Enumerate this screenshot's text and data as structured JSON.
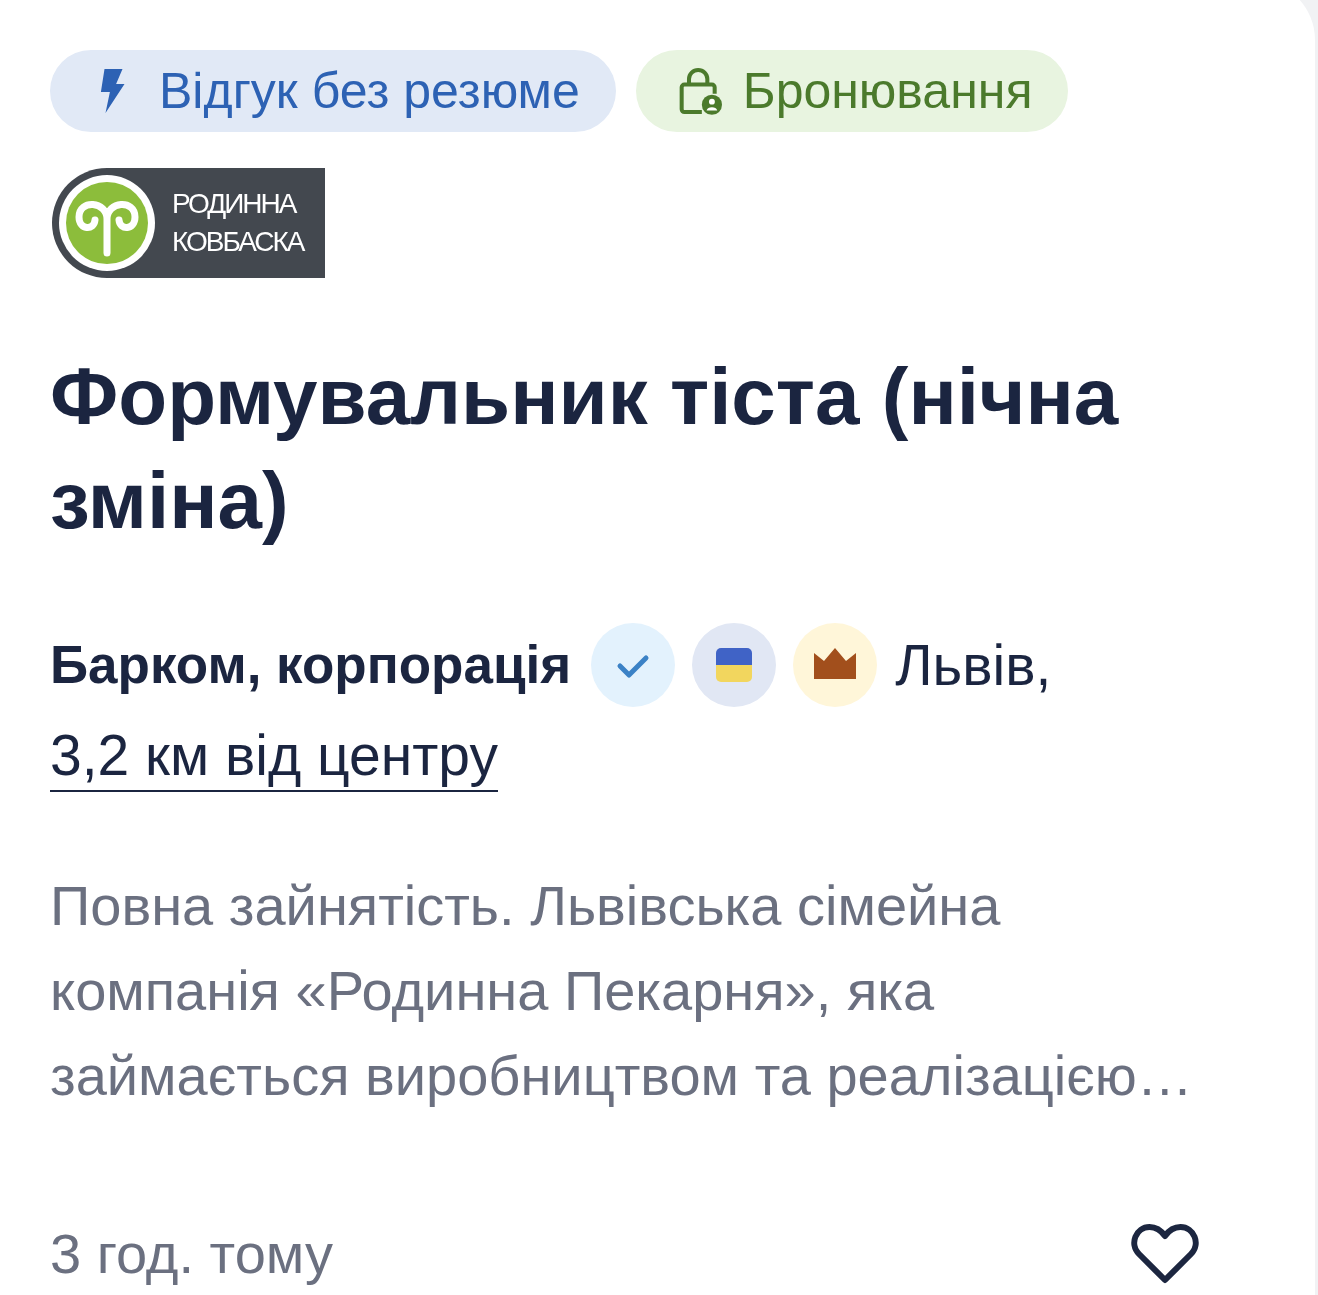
{
  "tags": [
    {
      "kind": "response",
      "label": "Відгук без резюме",
      "color": "#2d62b4"
    },
    {
      "kind": "reservation",
      "label": "Бронювання",
      "color": "#4b7a2c"
    }
  ],
  "logo": {
    "lines": [
      "РОДИННА",
      "КОВБАСКА"
    ]
  },
  "title": "Формувальник тіста (нічна зміна)",
  "company": {
    "name": "Барком, корпорація",
    "city": "Львів,",
    "distance": "3,2 км від центру"
  },
  "description": "Повна зайнятість. Львівська сімейна компанія «Родинна Пекарня», яка займається виробництвом та реалізацією…",
  "posted": "3 год. тому",
  "saved": false
}
